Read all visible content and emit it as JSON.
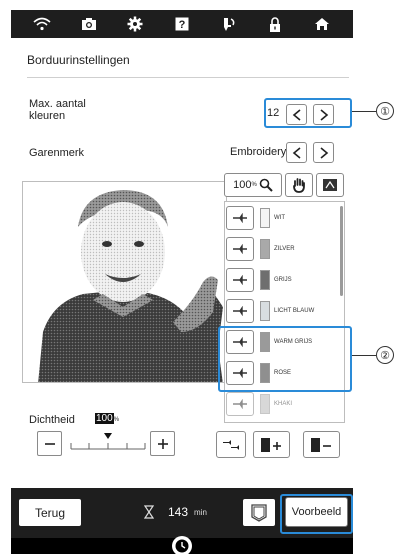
{
  "topbar": {
    "icons": [
      "wifi-icon",
      "camera-icon",
      "gear-icon",
      "help-icon",
      "needle-icon",
      "lock-icon",
      "home-icon"
    ]
  },
  "header": {
    "title": "Borduurinstellingen"
  },
  "settings": {
    "max_colors_label": "Max. aantal\nkleuren",
    "max_colors_value": "12",
    "thread_brand_label": "Garenmerk",
    "thread_brand_value": "Embroidery"
  },
  "tools": {
    "zoom_label": "100",
    "zoom_unit": "%"
  },
  "colors": [
    {
      "name": "WIT",
      "hex": "#f4f4f4",
      "dimmed": false
    },
    {
      "name": "ZILVER",
      "hex": "#a9a9a9",
      "dimmed": false
    },
    {
      "name": "GRIJS",
      "hex": "#6f6f6f",
      "dimmed": false
    },
    {
      "name": "LICHT BLAUW",
      "hex": "#d8dde0",
      "dimmed": false
    },
    {
      "name": "WARM GRIJS",
      "hex": "#9a9a9a",
      "dimmed": false
    },
    {
      "name": "ROSE",
      "hex": "#8f8f8f",
      "dimmed": false
    },
    {
      "name": "KHAKI",
      "hex": "#b9b9b9",
      "dimmed": true
    }
  ],
  "density": {
    "label": "Dichtheid",
    "value": "100",
    "unit": "%",
    "level": 0.5
  },
  "callouts": [
    "①",
    "②"
  ],
  "footer": {
    "back_label": "Terug",
    "time_value": "143",
    "time_unit": "min",
    "preview_label": "Voorbeeld"
  },
  "accent_color": "#2a8bd8"
}
